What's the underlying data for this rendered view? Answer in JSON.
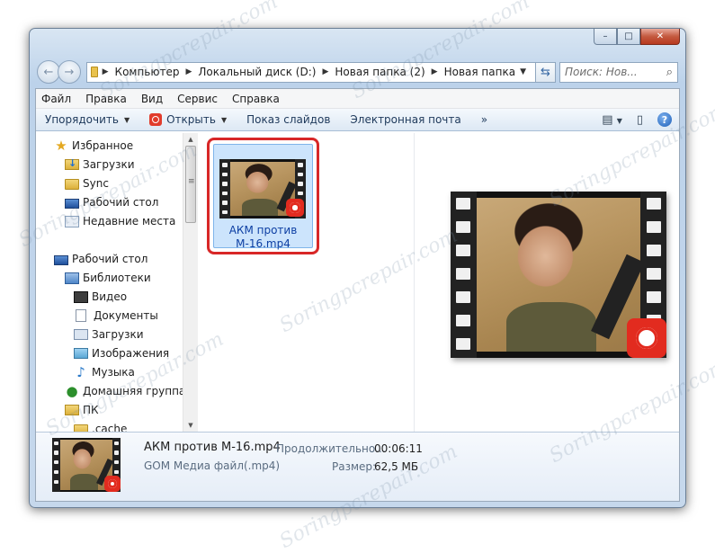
{
  "address": {
    "crumbs": [
      "Компьютер",
      "Локальный диск (D:)",
      "Новая папка (2)",
      "Новая папка"
    ]
  },
  "search": {
    "placeholder": "Поиск: Нов..."
  },
  "menu": [
    "Файл",
    "Правка",
    "Вид",
    "Сервис",
    "Справка"
  ],
  "toolbar": {
    "organize": "Упорядочить",
    "open": "Открыть",
    "slideshow": "Показ слайдов",
    "email": "Электронная почта",
    "more": "»"
  },
  "navigation": {
    "favorites": "Избранное",
    "downloads": "Загрузки",
    "sync": "Sync",
    "desktop_fav": "Рабочий стол",
    "recent": "Недавние места",
    "desktop": "Рабочий стол",
    "libraries": "Библиотеки",
    "video": "Видео",
    "documents": "Документы",
    "downloads_lib": "Загрузки",
    "images": "Изображения",
    "music": "Музыка",
    "homegroup": "Домашняя группа",
    "pc": "ПК",
    "cache": ".cache"
  },
  "file": {
    "name_line1": "АКМ против",
    "name_line2": "М-16.mp4"
  },
  "details": {
    "filename": "АКМ против М-16.mp4",
    "type": "GOM Медиа файл(.mp4)",
    "duration_label": "Продолжительно...",
    "duration_value": "00:06:11",
    "size_label": "Размер:",
    "size_value": "62,5 МБ"
  },
  "watermark": "Soringpcrepair.com",
  "colors": {
    "selection_highlight": "#d82727",
    "gom_badge": "#e22b1f"
  }
}
